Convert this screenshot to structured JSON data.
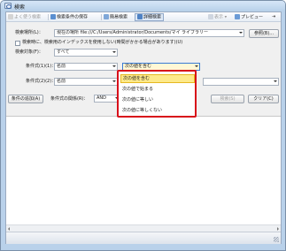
{
  "window": {
    "title": "検索"
  },
  "toolbar": {
    "recent": "よく使う検索",
    "save_condition": "検索条件の保存",
    "simple_search": "簡易検索",
    "detail_search": "詳細検索",
    "view": "表示",
    "preview": "プレビュー"
  },
  "form": {
    "location_label": "検索場所(L)：",
    "location_value": "現在の場所 file:///C:/Users/Administrator/Documents/マイ ライブラリー",
    "browse_button": "参照(B)...",
    "fulltext_checkbox_label": "検索時に、検索用のインデックスを使用しない(時間がかかる場合があります)(U)",
    "target_label": "検索対象(F)：",
    "target_value": "すべて",
    "condition1_label": "条件式(1)(1)：",
    "condition1_field": "名前",
    "condition1_op": "次の値を含む",
    "condition2_label": "条件式(2)(2)：",
    "condition2_field": "名前",
    "add_condition_button": "条件の追加(A)",
    "relation_label": "条件式の関係(R)：",
    "relation_value": "AND",
    "search_button": "検索(S)",
    "clear_button": "クリア(C)"
  },
  "operator_dropdown": {
    "options": [
      "次の値を含む",
      "次の値で始まる",
      "次の値に等しい",
      "次の値に等しくない"
    ],
    "selected_index": 0
  }
}
